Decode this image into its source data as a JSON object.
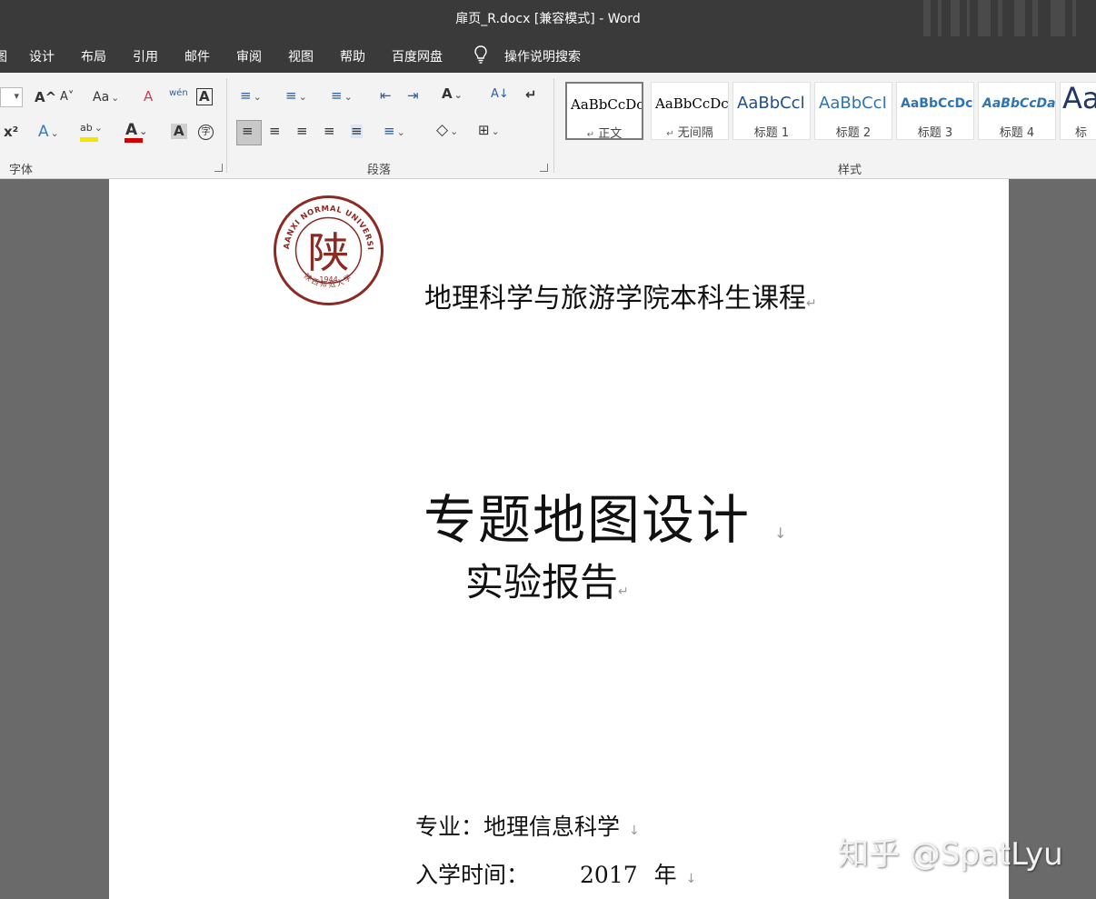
{
  "window": {
    "title": "扉页_R.docx [兼容模式]  -  Word"
  },
  "menu": {
    "partial": "图",
    "items": [
      "设计",
      "布局",
      "引用",
      "邮件",
      "审阅",
      "视图",
      "帮助",
      "百度网盘"
    ],
    "search": "操作说明搜索"
  },
  "ribbon": {
    "groups": {
      "font": "字体",
      "paragraph": "段落",
      "styles": "样式"
    },
    "icons": {
      "grow_font": "A^",
      "shrink_font": "A˅",
      "change_case": "Aa",
      "clear_format": "A",
      "phonetic": "wén",
      "char_border": "A",
      "superscript": "x²",
      "text_effects": "A",
      "highlight": "ab",
      "font_color": "A",
      "char_shading": "A",
      "enclose": "字",
      "bullets": "≡",
      "numbering": "≡",
      "multilevel": "≡",
      "decrease_indent": "⇤",
      "increase_indent": "⇥",
      "chinese_layout": "A",
      "sort": "A↓",
      "show_marks": "↵",
      "align_left": "≡",
      "center": "≡",
      "align_right": "≡",
      "justify": "≡",
      "distributed": "≡",
      "line_spacing": "≡",
      "shading": "◇",
      "borders": "⊞"
    },
    "styles": [
      {
        "sample": "AaBbCcDc",
        "name": "正文",
        "mark": "↵"
      },
      {
        "sample": "AaBbCcDc",
        "name": "无间隔",
        "mark": "↵"
      },
      {
        "sample": "AaBbCcl",
        "name": "标题 1"
      },
      {
        "sample": "AaBbCcI",
        "name": "标题 2"
      },
      {
        "sample": "AaBbCcDc",
        "name": "标题 3"
      },
      {
        "sample": "AaBbCcDa",
        "name": "标题 4"
      },
      {
        "sample": "Aa",
        "name": "标"
      }
    ],
    "colors": {
      "highlight": "#f5e600",
      "font_color": "#d00000",
      "heading_blue": "#2e74b5"
    }
  },
  "document": {
    "logo": {
      "top_text": "SHAANXI NORMAL UNIVERSITY",
      "year": "1944",
      "char": "陕",
      "bottom_text": "陕西师范大学",
      "color": "#8b2a23"
    },
    "college": "地理科学与旅游学院本科生课程",
    "title": "专题地图设计",
    "subtitle": "实验报告",
    "major_label": "专业：",
    "major_value": "地理信息科学",
    "year_label": "入学时间：",
    "year_value": "2017",
    "year_unit": "年",
    "para_mark": "↵",
    "line_mark": "↓"
  },
  "watermark": "知乎 @SpatLyu"
}
